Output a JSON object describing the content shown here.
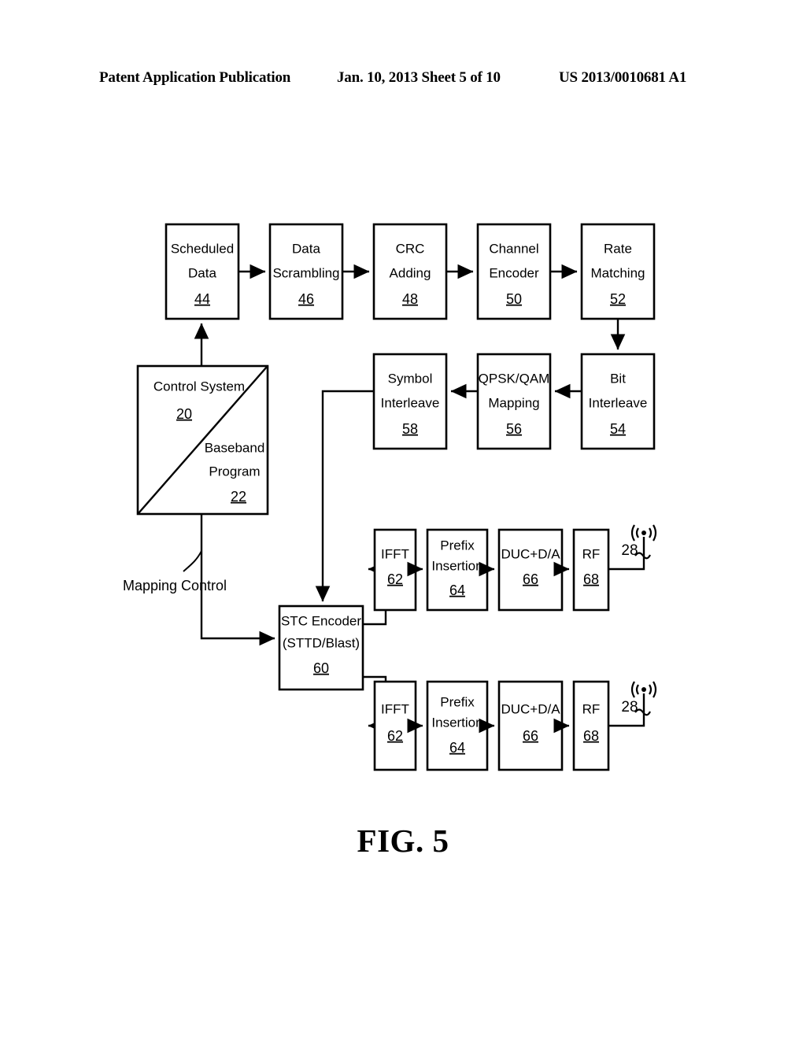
{
  "header": {
    "publication": "Patent Application Publication",
    "date_sheet": "Jan. 10, 2013  Sheet 5 of 10",
    "patent_number": "US 2013/0010681 A1"
  },
  "figure": {
    "caption": "FIG. 5"
  },
  "diagram": {
    "type": "block-diagram",
    "labels": {
      "mapping_control": "Mapping Control"
    },
    "blocks": [
      {
        "id": "scheduled_data",
        "lines": [
          "Scheduled",
          "Data"
        ],
        "ref": "44"
      },
      {
        "id": "data_scrambling",
        "lines": [
          "Data",
          "Scrambling"
        ],
        "ref": "46"
      },
      {
        "id": "crc_adding",
        "lines": [
          "CRC",
          "Adding"
        ],
        "ref": "48"
      },
      {
        "id": "channel_encoder",
        "lines": [
          "Channel",
          "Encoder"
        ],
        "ref": "50"
      },
      {
        "id": "rate_matching",
        "lines": [
          "Rate",
          "Matching"
        ],
        "ref": "52"
      },
      {
        "id": "bit_interleave",
        "lines": [
          "Bit",
          "Interleave"
        ],
        "ref": "54"
      },
      {
        "id": "qpsk_qam_mapping",
        "lines": [
          "QPSK/QAM",
          "Mapping"
        ],
        "ref": "56"
      },
      {
        "id": "symbol_interleave",
        "lines": [
          "Symbol",
          "Interleave"
        ],
        "ref": "58"
      },
      {
        "id": "control_system",
        "lines": [
          "Control System"
        ],
        "ref": "20"
      },
      {
        "id": "baseband_program",
        "lines": [
          "Baseband",
          "Program"
        ],
        "ref": "22"
      },
      {
        "id": "stc_encoder",
        "lines": [
          "STC Encoder",
          "(STTD/Blast)"
        ],
        "ref": "60"
      },
      {
        "id": "ifft_upper",
        "lines": [
          "IFFT"
        ],
        "ref": "62"
      },
      {
        "id": "prefix_upper",
        "lines": [
          "Prefix",
          "Insertion"
        ],
        "ref": "64"
      },
      {
        "id": "duc_da_upper",
        "lines": [
          "DUC+D/A"
        ],
        "ref": "66"
      },
      {
        "id": "rf_upper",
        "lines": [
          "RF"
        ],
        "ref": "68"
      },
      {
        "id": "ifft_lower",
        "lines": [
          "IFFT"
        ],
        "ref": "62"
      },
      {
        "id": "prefix_lower",
        "lines": [
          "Prefix",
          "Insertion"
        ],
        "ref": "64"
      },
      {
        "id": "duc_da_lower",
        "lines": [
          "DUC+D/A"
        ],
        "ref": "66"
      },
      {
        "id": "rf_lower",
        "lines": [
          "RF"
        ],
        "ref": "68"
      }
    ],
    "antennas": [
      {
        "id": "antenna_upper",
        "ref": "28"
      },
      {
        "id": "antenna_lower",
        "ref": "28"
      }
    ]
  }
}
